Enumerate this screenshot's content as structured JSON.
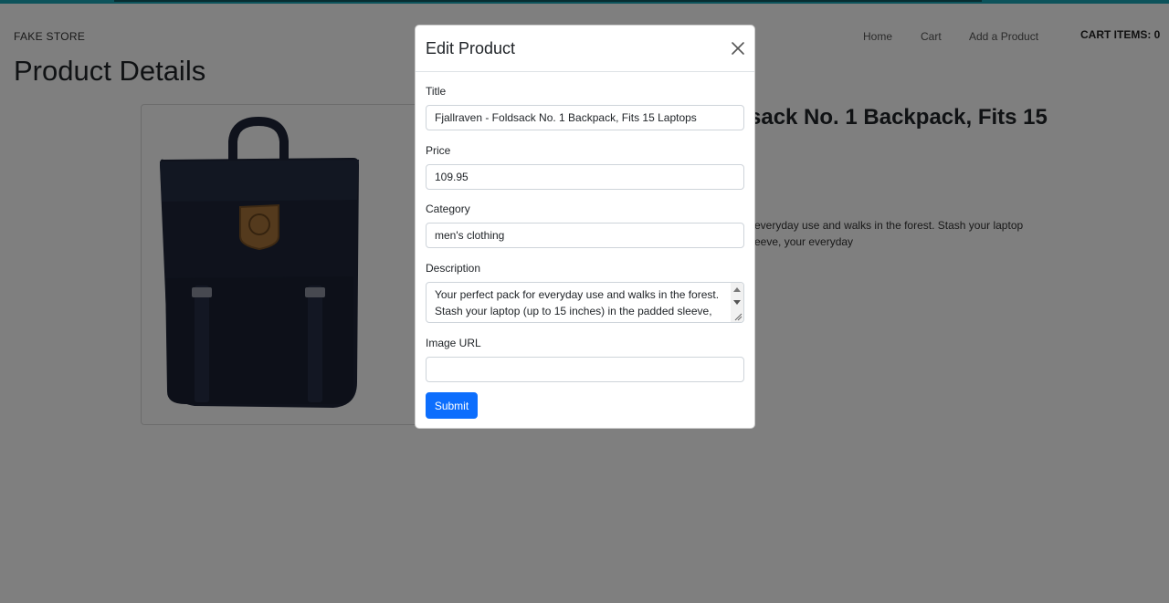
{
  "nav": {
    "brand": "FAKE STORE",
    "links": [
      "Home",
      "Cart",
      "Add a Product"
    ],
    "cart_items": "CART ITEMS: 0"
  },
  "page": {
    "title": "Product Details",
    "product_title_visible": "sack No. 1 Backpack, Fits 15",
    "product_desc_line1": "everyday use and walks in the forest. Stash your laptop",
    "product_desc_line2": "eeve, your everyday"
  },
  "modal": {
    "title": "Edit Product",
    "fields": {
      "title_label": "Title",
      "title_value": "Fjallraven - Foldsack No. 1 Backpack, Fits 15 Laptops",
      "price_label": "Price",
      "price_value": "109.95",
      "category_label": "Category",
      "category_value": "men's clothing",
      "description_label": "Description",
      "description_value": "Your perfect pack for everyday use and walks in the forest. Stash your laptop (up to 15 inches) in the padded sleeve,",
      "image_label": "Image URL",
      "image_value": ""
    },
    "submit_label": "Submit"
  },
  "colors": {
    "accent": "#0d6efd",
    "backpack": "#1e2538",
    "patch": "#a8743a"
  },
  "icons": [
    "close-icon",
    "scroll-up-icon",
    "scroll-down-icon",
    "resize-grip-icon",
    "backpack-image"
  ]
}
